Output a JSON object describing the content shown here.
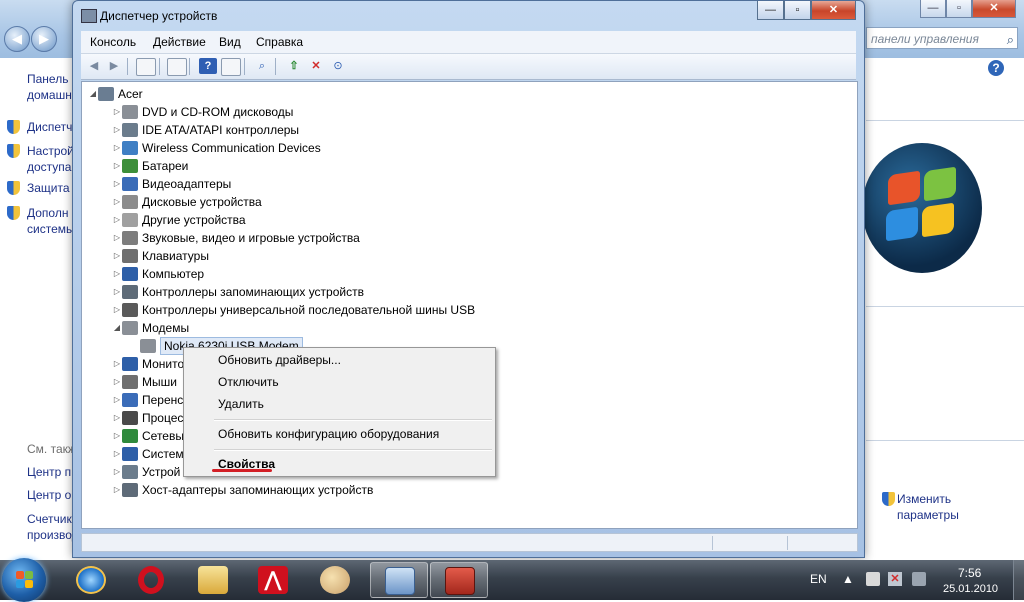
{
  "background_window": {
    "search_placeholder": "панели управления",
    "left_links": [
      {
        "label": "Панель",
        "shield": false
      },
      {
        "label": "домашн",
        "shield": false
      },
      {
        "label": "Диспетч",
        "shield": true
      },
      {
        "label": "Настрой",
        "shield": true
      },
      {
        "label": "доступа",
        "shield": false
      },
      {
        "label": "Защита",
        "shield": true
      },
      {
        "label": "Дополн",
        "shield": true
      },
      {
        "label": "системы",
        "shield": false
      }
    ],
    "see_also": "См. такж",
    "bottom_links": [
      "Центр п",
      "Центр о",
      "Счетчик",
      "производ"
    ],
    "change_params_line1": "Изменить",
    "change_params_line2": "параметры"
  },
  "device_manager": {
    "title": "Диспетчер устройств",
    "menu": [
      "Консоль",
      "Действие",
      "Вид",
      "Справка"
    ],
    "root": "Acer",
    "categories": [
      {
        "label": "DVD и CD-ROM дисководы",
        "icon_color": "#8a8f96",
        "expanded": false
      },
      {
        "label": "IDE ATA/ATAPI контроллеры",
        "icon_color": "#6b7c8c",
        "expanded": false
      },
      {
        "label": "Wireless Communication Devices",
        "icon_color": "#3f7fc4",
        "expanded": false
      },
      {
        "label": "Батареи",
        "icon_color": "#3d8f3a",
        "expanded": false
      },
      {
        "label": "Видеоадаптеры",
        "icon_color": "#3a6cb8",
        "expanded": false
      },
      {
        "label": "Дисковые устройства",
        "icon_color": "#8c8c8c",
        "expanded": false
      },
      {
        "label": "Другие устройства",
        "icon_color": "#a0a0a0",
        "expanded": false
      },
      {
        "label": "Звуковые, видео и игровые устройства",
        "icon_color": "#7d7d7d",
        "expanded": false
      },
      {
        "label": "Клавиатуры",
        "icon_color": "#6f6f6f",
        "expanded": false
      },
      {
        "label": "Компьютер",
        "icon_color": "#2e5fa8",
        "expanded": false
      },
      {
        "label": "Контроллеры запоминающих устройств",
        "icon_color": "#5e6b78",
        "expanded": false
      },
      {
        "label": "Контроллеры универсальной последовательной шины USB",
        "icon_color": "#5a5a5a",
        "expanded": false
      },
      {
        "label": "Модемы",
        "icon_color": "#8a8f96",
        "expanded": true
      }
    ],
    "modem_child": "Nokia 6230i USB Modem",
    "categories_after": [
      {
        "label": "Монито",
        "icon_color": "#2e5fa8"
      },
      {
        "label": "Мыши",
        "icon_color": "#6f6f6f"
      },
      {
        "label": "Перенс",
        "icon_color": "#3a6cb8"
      },
      {
        "label": "Процес",
        "icon_color": "#4a4a4a"
      },
      {
        "label": "Сетевы",
        "icon_color": "#2f8a3c"
      },
      {
        "label": "Систем",
        "icon_color": "#2e5fa8"
      },
      {
        "label": "Устрой",
        "icon_color": "#6b7c8c"
      },
      {
        "label": "Хост-адаптеры запоминающих устройств",
        "icon_color": "#5e6b78"
      }
    ]
  },
  "context_menu": {
    "items": [
      "Обновить драйверы...",
      "Отключить",
      "Удалить",
      "Обновить конфигурацию оборудования",
      "Свойства"
    ]
  },
  "taskbar": {
    "language": "EN",
    "time": "7:56",
    "date": "25.01.2010"
  }
}
